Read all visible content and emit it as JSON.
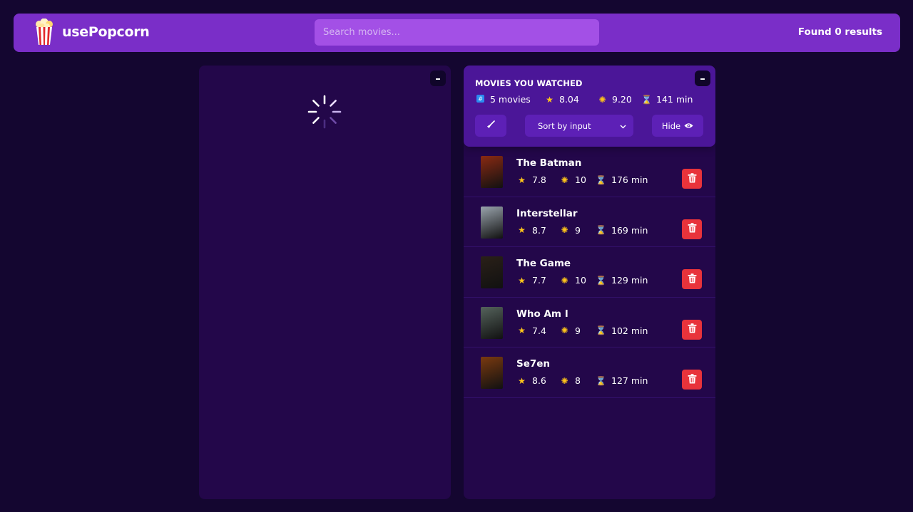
{
  "nav": {
    "app_name": "usePopcorn",
    "search_placeholder": "Search movies...",
    "search_value": "",
    "results_text": "Found 0 results"
  },
  "left_box": {
    "toggle_label": "–",
    "state": "loading"
  },
  "watched": {
    "toggle_label": "–",
    "title": "Movies you watched",
    "summary": {
      "count": "5 movies",
      "imdb_avg": "8.04",
      "user_avg": "9.20",
      "runtime_avg": "141 min"
    },
    "sort_label": "Sort by input",
    "hide_label": "Hide",
    "movies": [
      {
        "title": "The Batman",
        "imdb": "7.8",
        "user": "10",
        "runtime": "176 min",
        "poster_color": "#8a2a12"
      },
      {
        "title": "Interstellar",
        "imdb": "8.7",
        "user": "9",
        "runtime": "169 min",
        "poster_color": "#9aa4ad"
      },
      {
        "title": "The Game",
        "imdb": "7.7",
        "user": "10",
        "runtime": "129 min",
        "poster_color": "#2a2018"
      },
      {
        "title": "Who Am I",
        "imdb": "7.4",
        "user": "9",
        "runtime": "102 min",
        "poster_color": "#55635c"
      },
      {
        "title": "Se7en",
        "imdb": "8.6",
        "user": "8",
        "runtime": "127 min",
        "poster_color": "#7a3a10"
      }
    ]
  },
  "icons": {
    "count": "hash-icon",
    "imdb": "star-icon",
    "user": "sun-icon",
    "runtime": "hourglass-icon",
    "clear": "broom-icon",
    "sort": "chevron-down-icon",
    "hide": "eye-icon",
    "delete": "trash-icon"
  },
  "colors": {
    "background": "#140630",
    "nav": "#7a2ec8",
    "box": "#23074a",
    "summary": "#4b1698",
    "delete": "#e8333b"
  }
}
